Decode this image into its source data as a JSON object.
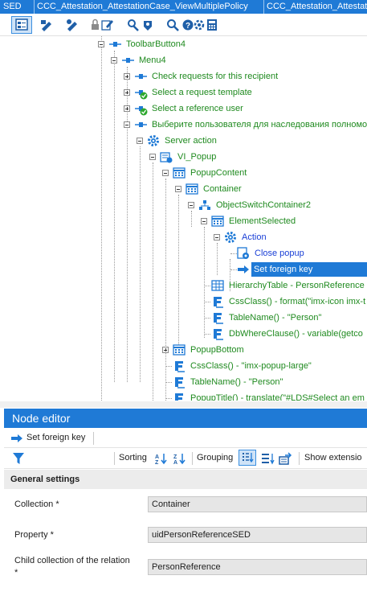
{
  "tabs": [
    {
      "label": "SED"
    },
    {
      "label": "CCC_Attestation_AttestationCase_ViewMultiplePolicy"
    },
    {
      "label": "CCC_Attestation_Attestat"
    }
  ],
  "toolbar_icons": [
    "tree-view-icon",
    "edit-sql-icon",
    "edit-config-icon",
    "lock-icon",
    "edit-icon",
    "settings-icon",
    "compile-icon",
    "search-icon",
    "help-icon",
    "calculator-icon"
  ],
  "tree": {
    "nodes": [
      {
        "label": "ToolbarButton4",
        "color": "#1f8a1f",
        "icon": "component-icon"
      },
      {
        "label": "Menu4",
        "color": "#1f8a1f",
        "icon": "component-icon"
      },
      {
        "label": "Check requests for this recipient",
        "color": "#1f8a1f",
        "icon": "component-icon"
      },
      {
        "label": "Select a request template",
        "color": "#1f8a1f",
        "icon": "component-check-icon"
      },
      {
        "label": "Select a reference user",
        "color": "#1f8a1f",
        "icon": "component-check-icon"
      },
      {
        "label": "Выберите пользователя для наследования полномочий",
        "color": "#1f8a1f",
        "icon": "component-icon"
      },
      {
        "label": "Server action",
        "color": "#1f8a1f",
        "icon": "gear-icon"
      },
      {
        "label": "VI_Popup",
        "color": "#1f8a1f",
        "icon": "popup-icon"
      },
      {
        "label": "PopupContent",
        "color": "#1f8a1f",
        "icon": "container-icon"
      },
      {
        "label": "Container",
        "color": "#1f8a1f",
        "icon": "container-icon"
      },
      {
        "label": "ObjectSwitchContainer2",
        "color": "#1f8a1f",
        "icon": "switch-icon"
      },
      {
        "label": "ElementSelected",
        "color": "#1f8a1f",
        "icon": "container-icon"
      },
      {
        "label": "Action",
        "color": "#1a3fd6",
        "icon": "gear-icon"
      },
      {
        "label": "Close popup",
        "color": "#1a3fd6",
        "icon": "action-icon"
      },
      {
        "label": "Set foreign key",
        "color": "#1a3fd6",
        "icon": "action-icon"
      },
      {
        "label": "HierarchyTable - PersonReference",
        "color": "#1f8a1f",
        "icon": "table-icon"
      },
      {
        "label": "CssClass() - format(\"imx-icon imx-t",
        "color": "#1f8a1f",
        "icon": "property-icon"
      },
      {
        "label": "TableName() - \"Person\"",
        "color": "#1f8a1f",
        "icon": "property-icon"
      },
      {
        "label": "DbWhereClause() - variable(getco",
        "color": "#1f8a1f",
        "icon": "property-icon"
      },
      {
        "label": "PopupBottom",
        "color": "#1f8a1f",
        "icon": "container-icon"
      },
      {
        "label": "CssClass() - \"imx-popup-large\"",
        "color": "#1f8a1f",
        "icon": "property-icon"
      },
      {
        "label": "TableName() - \"Person\"",
        "color": "#1f8a1f",
        "icon": "property-icon"
      },
      {
        "label": "PopupTitle() - translate(\"#LDS#Select an em",
        "color": "#1f8a1f",
        "icon": "property-icon"
      }
    ]
  },
  "node_editor": {
    "title": "Node editor",
    "node_label": "Set foreign key",
    "sorting_label": "Sorting",
    "grouping_label": "Grouping",
    "show_extensions_label": "Show extensio",
    "general_settings_label": "General settings",
    "properties": [
      {
        "label": "Collection *",
        "value": "Container"
      },
      {
        "label": "Property *",
        "value": "uidPersonReferenceSED"
      },
      {
        "label": "Child collection of the relation *",
        "value": "PersonReference"
      }
    ]
  }
}
